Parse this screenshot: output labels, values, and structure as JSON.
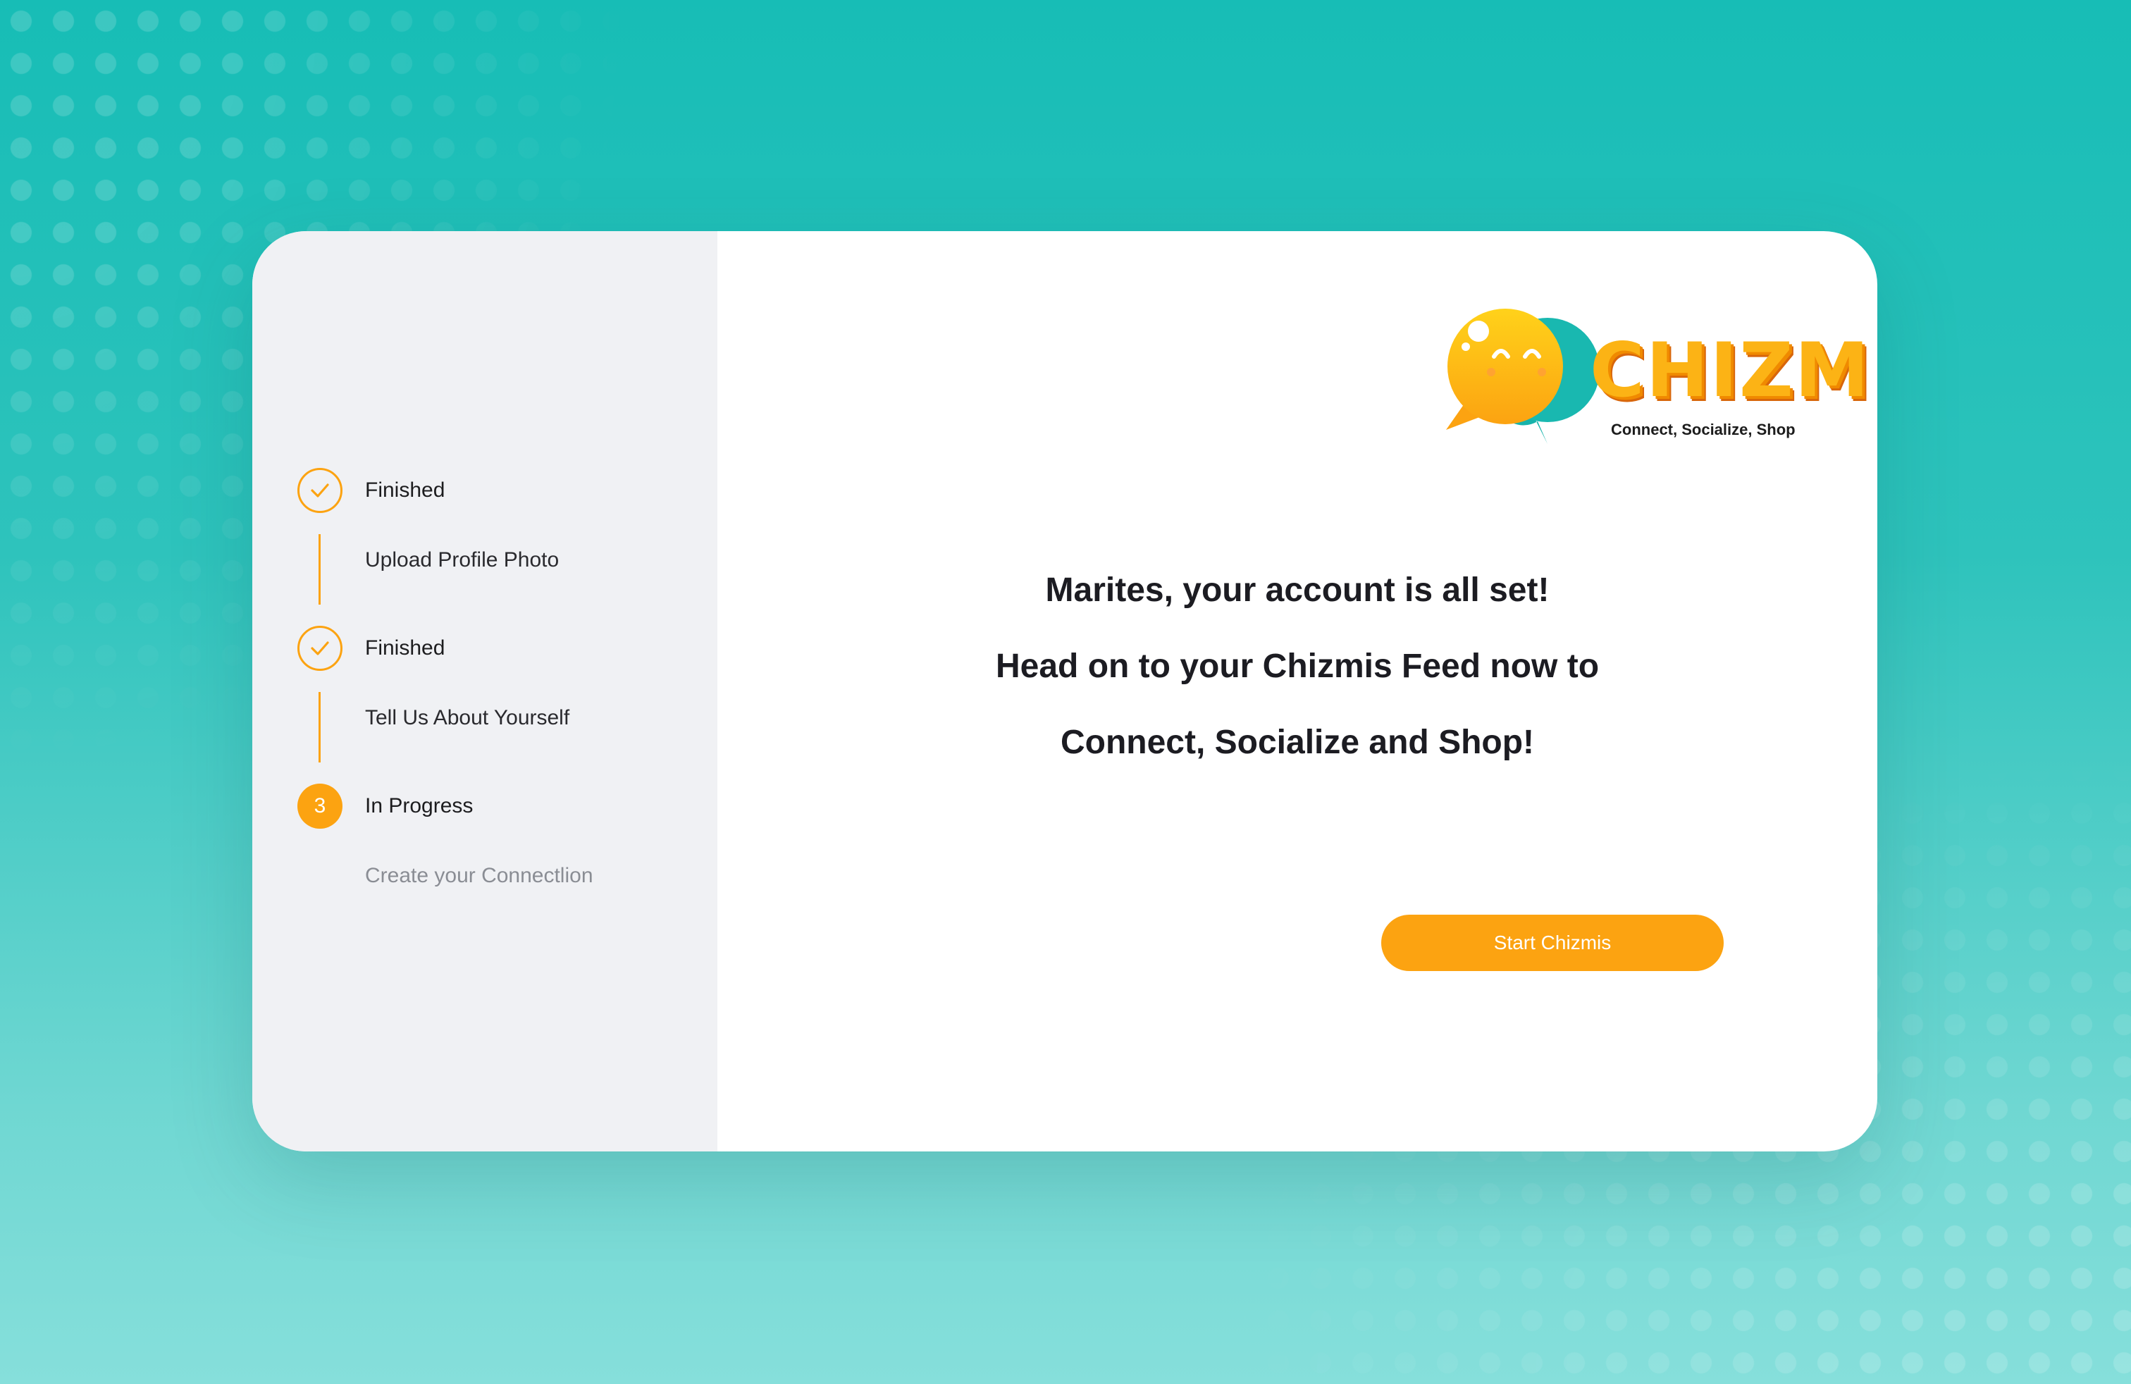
{
  "colors": {
    "accent": "#fca311",
    "background_teal": "#1bbdb6",
    "sidebar_bg": "#f0f1f4",
    "text_dark": "#1c1c22",
    "text_muted": "#8a8d94"
  },
  "logo": {
    "wordmark": "CHIZMIS",
    "tagline": "Connect, Socialize, Shop",
    "icon": "chat-bubbles-smiley-icon"
  },
  "steps": [
    {
      "status": "Finished",
      "title": "Upload Profile Photo",
      "icon": "check-icon"
    },
    {
      "status": "Finished",
      "title": "Tell Us About Yourself",
      "icon": "check-icon"
    },
    {
      "status": "In Progress",
      "title": "Create your Connectlion",
      "number": "3"
    }
  ],
  "message": {
    "line1": "Marites, your account is all set!",
    "line2": "Head on to your Chizmis Feed now to",
    "line3": "Connect, Socialize and Shop!"
  },
  "cta": {
    "label": "Start Chizmis"
  }
}
